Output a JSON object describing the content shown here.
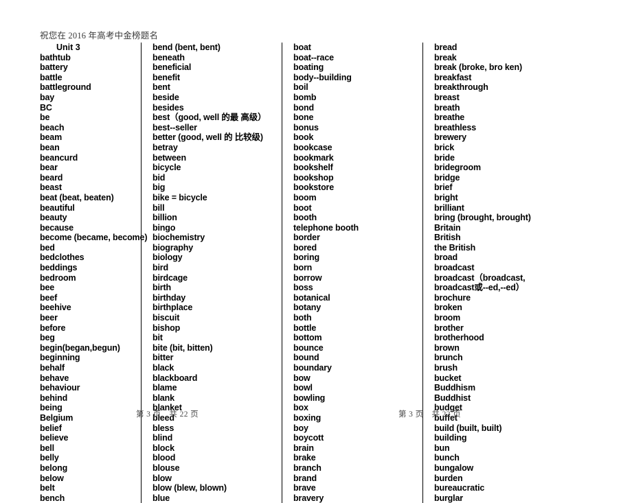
{
  "header": {
    "blessing": "祝您在 2016 年高考中金榜题名",
    "unit_title": "Unit 3"
  },
  "columns": [
    {
      "id": "column-1",
      "words": [
        "bathtub",
        "battery",
        "battle",
        "battleground",
        "bay",
        "BC",
        "be",
        "beach",
        "beam",
        "bean",
        "beancurd",
        "bear",
        "beard",
        "beast",
        "beat (beat, beaten)",
        "beautiful",
        "beauty",
        "because",
        "become (became, become)",
        "bed",
        "bedclothes",
        "beddings",
        "bedroom",
        "bee",
        "beef",
        "beehive",
        "beer",
        "before",
        "beg",
        "begin(began,begun)",
        "beginning",
        "behalf",
        "behave",
        "behaviour",
        "behind",
        "being",
        "Belgium",
        "belief",
        "believe",
        "bell",
        "belly",
        "belong",
        "below",
        "belt",
        "bench"
      ]
    },
    {
      "id": "column-2",
      "words": [
        "bend (bent, bent)",
        "beneath",
        "beneficial",
        "benefit",
        "bent",
        "beside",
        "besides",
        "best（good, well 的最 高级）",
        "best--seller",
        "better (good, well 的 比较级)",
        "betray",
        "between",
        "bicycle",
        "bid",
        "big",
        "bike = bicycle",
        "bill",
        "billion",
        "bingo",
        "biochemistry",
        "biography",
        "biology",
        "bird",
        "birdcage",
        "birth",
        "birthday",
        "birthplace",
        "biscuit",
        "bishop",
        "bit",
        "bite (bit, bitten)",
        "bitter",
        "black",
        "blackboard",
        "blame",
        "blank",
        "blanket",
        "bleed",
        "bless",
        "blind",
        "block",
        "blood",
        "blouse",
        "blow",
        "blow (blew, blown)",
        "blue"
      ]
    },
    {
      "id": "column-3",
      "words": [
        "boat",
        "boat--race",
        "boating",
        "body--building",
        "boil",
        "bomb",
        "bond",
        "bone",
        "bonus",
        "book",
        "bookcase",
        "bookmark",
        "bookshelf",
        "bookshop",
        "bookstore",
        "boom",
        "boot",
        "booth",
        "telephone booth",
        "border",
        "bored",
        "boring",
        "born",
        "borrow",
        "boss",
        "botanical",
        "botany",
        "both",
        "bottle",
        "bottom",
        "bounce",
        "bound",
        "boundary",
        "bow",
        "bowl",
        "bowling",
        "box",
        "boxing",
        "boy",
        "boycott",
        "brain",
        "brake",
        "branch",
        "brand",
        "brave",
        "bravery"
      ]
    },
    {
      "id": "column-4",
      "words": [
        "bread",
        "break",
        "break (broke, bro ken)",
        "breakfast",
        "breakthrough",
        "breast",
        "breath",
        "breathe",
        "breathless",
        "brewery",
        "brick",
        "bride",
        "bridegroom",
        "bridge",
        "brief",
        "bright",
        "brilliant",
        "bring (brought, brought)",
        "Britain",
        "British",
        "the British",
        "broad",
        "broadcast",
        "broadcast（broadcast,",
        "broadcast或--ed,--ed）",
        "brochure",
        "broken",
        "broom",
        "brother",
        "brotherhood",
        "brown",
        "brunch",
        "brush",
        "bucket",
        "Buddhism",
        "Buddhist",
        "budget",
        "buffet",
        "build (built, built)",
        "building",
        "bun",
        "bunch",
        "bungalow",
        "burden",
        "bureaucratic",
        "burglar"
      ]
    }
  ],
  "footer": {
    "left": "第 3 页　共 22 页",
    "right": "第 3 页　共 22 页"
  }
}
